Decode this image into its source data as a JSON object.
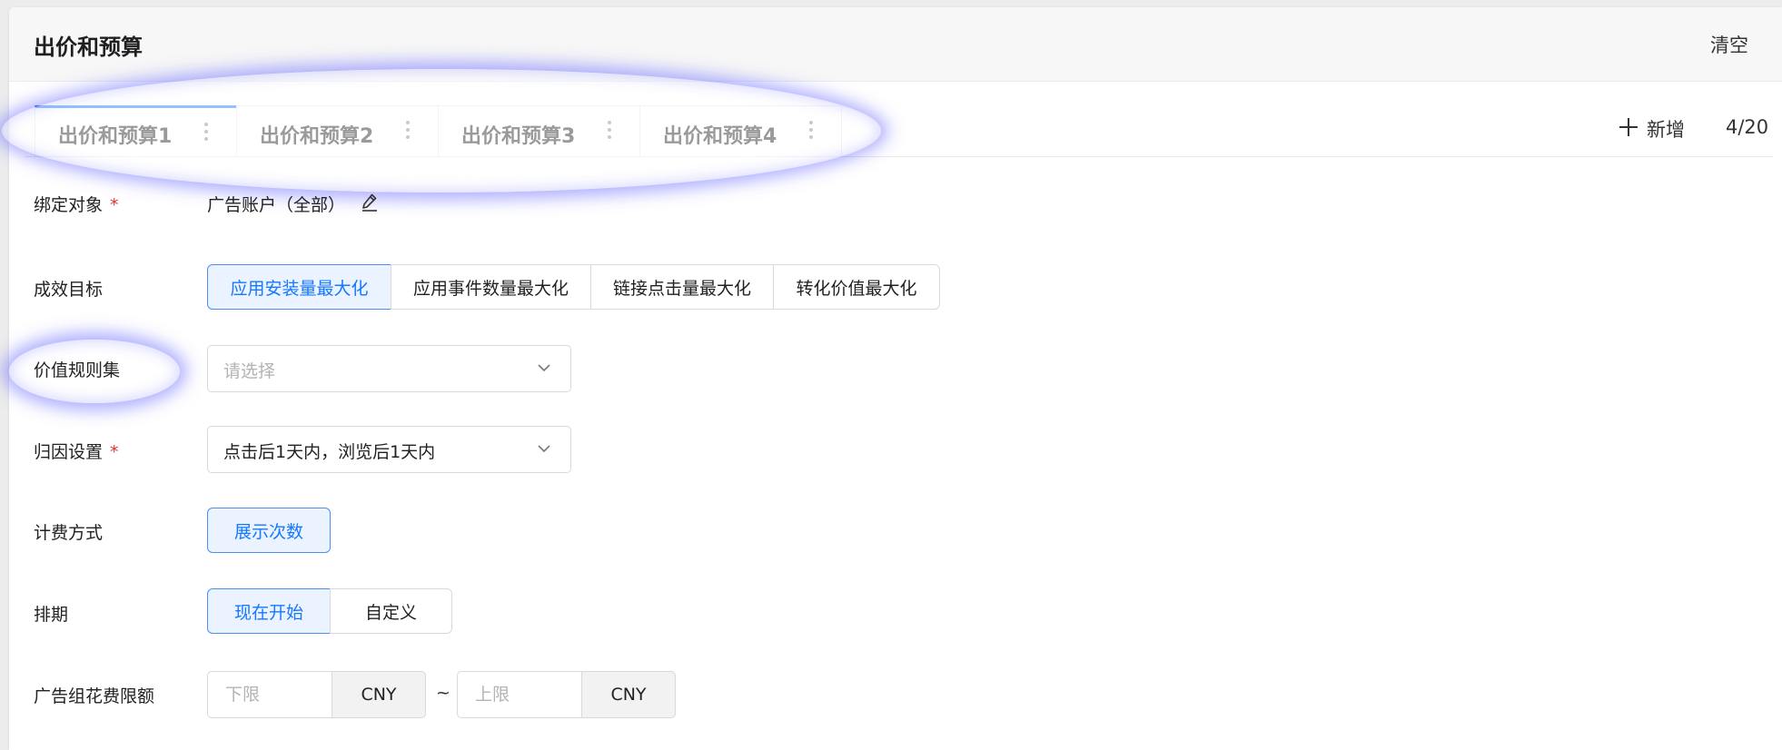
{
  "header": {
    "title": "出价和预算",
    "clear_label": "清空"
  },
  "tabs": [
    {
      "label": "出价和预算1",
      "active": true
    },
    {
      "label": "出价和预算2",
      "active": false
    },
    {
      "label": "出价和预算3",
      "active": false
    },
    {
      "label": "出价和预算4",
      "active": false
    }
  ],
  "tab_actions": {
    "add_label": "新增",
    "count": "4/20"
  },
  "form": {
    "bind_object": {
      "label": "绑定对象",
      "required": "*",
      "value": "广告账户（全部）"
    },
    "goal": {
      "label": "成效目标",
      "options": [
        "应用安装量最大化",
        "应用事件数量最大化",
        "链接点击量最大化",
        "转化价值最大化"
      ],
      "selected": "应用安装量最大化"
    },
    "value_rule_set": {
      "label": "价值规则集",
      "placeholder": "请选择"
    },
    "attribution": {
      "label": "归因设置",
      "required": "*",
      "value": "点击后1天内，浏览后1天内"
    },
    "billing": {
      "label": "计费方式",
      "options": [
        "展示次数"
      ],
      "selected": "展示次数"
    },
    "schedule": {
      "label": "排期",
      "options": [
        "现在开始",
        "自定义"
      ],
      "selected": "现在开始"
    },
    "spend_limit": {
      "label": "广告组花费限额",
      "lower_placeholder": "下限",
      "upper_placeholder": "上限",
      "currency": "CNY",
      "separator": "~"
    }
  },
  "colors": {
    "accent": "#1677ff",
    "required": "#e0332f",
    "highlight_glow": "#6e6eff"
  },
  "icons": {
    "tab_more": "vertical-dots-icon",
    "add": "plus-icon",
    "edit": "pencil-icon",
    "select_arrow": "chevron-down-icon"
  }
}
